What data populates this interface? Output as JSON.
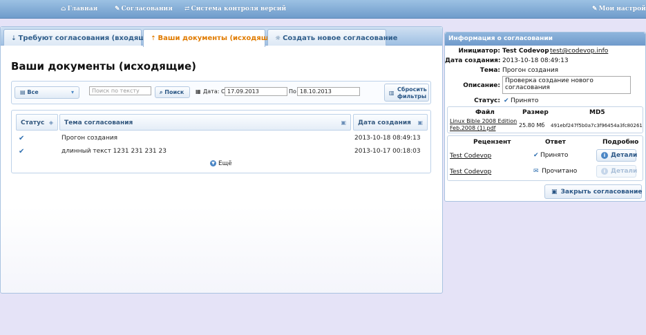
{
  "topbar": {
    "items": [
      {
        "icon": "home-icon",
        "label": "Главная"
      },
      {
        "icon": "pencil-icon",
        "label": "Согласования"
      },
      {
        "icon": "arrows-icon",
        "label": "Система контроля версий"
      }
    ],
    "settings_label": "Мои настройки"
  },
  "tabs": [
    {
      "label": "Требуют согласования (входящие)",
      "active": false
    },
    {
      "label": "Ваши документы (исходящие)",
      "active": true
    },
    {
      "label": "Создать новое согласование",
      "active": false
    }
  ],
  "page_title": "Ваши документы (исходящие)",
  "filters": {
    "select_value": "Все",
    "search_placeholder": "Поиск по тексту",
    "search_button": "Поиск",
    "date_label": "Дата: С",
    "date_from": "17.09.2013",
    "date_to_label": "По",
    "date_to": "18.10.2013",
    "reset_line1": "Сбросить",
    "reset_line2": "фильтры"
  },
  "table": {
    "columns": [
      "Статус",
      "Тема согласования",
      "Дата создания"
    ],
    "rows": [
      {
        "status": "accepted",
        "subject": "Прогон создания",
        "date": "2013-10-18 08:49:13"
      },
      {
        "status": "accepted",
        "subject": "длинный текст 1231 231 231 23",
        "date": "2013-10-17 00:18:03"
      }
    ],
    "more_label": "Ещё"
  },
  "info": {
    "header": "Информация о согласовании",
    "initiator_label": "Инициатор:",
    "initiator_name": "Test Codevop",
    "initiator_email": "test@codevop.info",
    "created_label": "Дата создания:",
    "created_value": "2013-10-18 08:49:13",
    "topic_label": "Тема:",
    "topic_value": "Прогон создания",
    "desc_label": "Описание:",
    "desc_value": "Проверка создание нового согласования",
    "status_label": "Статус:",
    "status_value": "Принято",
    "files": {
      "columns": [
        "Файл",
        "Размер",
        "MD5"
      ],
      "rows": [
        {
          "name_line1": "Linux Bible 2008 Edition",
          "name_line2": "Feb.2008 (1).pdf",
          "size": "25.80 Мб",
          "md5": "491ebf247f5b0a7c3f96454a3fc80261"
        }
      ]
    },
    "reviewers": {
      "columns": [
        "Рецензент",
        "Ответ",
        "Подробно"
      ],
      "rows": [
        {
          "name": "Test Codevop",
          "answer": "Принято",
          "answer_icon": "check-icon",
          "details": "Детали",
          "enabled": true
        },
        {
          "name": "Test Codevop",
          "answer": "Прочитано",
          "answer_icon": "envelope-icon",
          "details": "Детали",
          "enabled": false
        }
      ]
    },
    "close_button": "Закрыть согласование"
  }
}
